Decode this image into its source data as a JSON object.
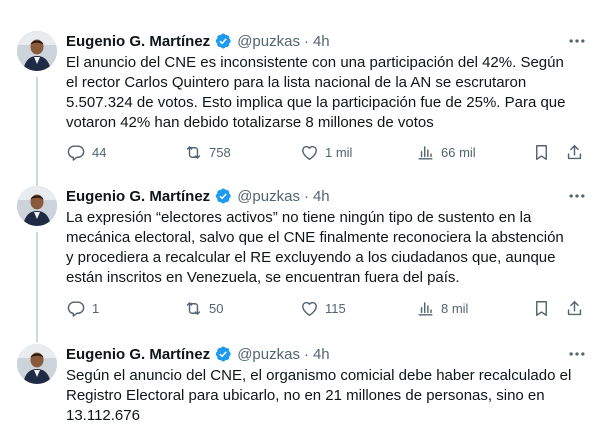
{
  "tweets": [
    {
      "name": "Eugenio G. Martínez",
      "handle": "@puzkas",
      "separator": "·",
      "time": "4h",
      "text": "El anuncio del CNE es inconsistente con una participación del 42%.  Según\nel rector Carlos Quintero para la lista nacional de la AN se escrutaron\n5.507.324 de votos. Esto implica que la participación fue de 25%. Para que\nvotaron 42% han debido totalizarse 8 millones de votos",
      "replies": "44",
      "retweets": "758",
      "likes": "1 mil",
      "views": "66 mil"
    },
    {
      "name": "Eugenio G. Martínez",
      "handle": "@puzkas",
      "separator": "·",
      "time": "4h",
      "text": "La expresión “electores activos” no tiene ningún tipo de sustento en la\nmecánica electoral, salvo que el CNE finalmente reconociera la abstención\ny procediera a recalcular el RE excluyendo a los ciudadanos que, aunque\nestán inscritos en Venezuela, se encuentran fuera del país.",
      "replies": "1",
      "retweets": "50",
      "likes": "115",
      "views": "8 mil"
    },
    {
      "name": "Eugenio G. Martínez",
      "handle": "@puzkas",
      "separator": "·",
      "time": "4h",
      "text": "Según el anuncio del CNE, el organismo comicial debe haber recalculado el\nRegistro Electoral para ubicarlo, no en 21 millones de personas, sino en\n13.112.676"
    }
  ],
  "colors": {
    "text": "#0f1419",
    "muted": "#536471",
    "verified": "#1d9bf0",
    "thread_line": "#cfd9de"
  }
}
